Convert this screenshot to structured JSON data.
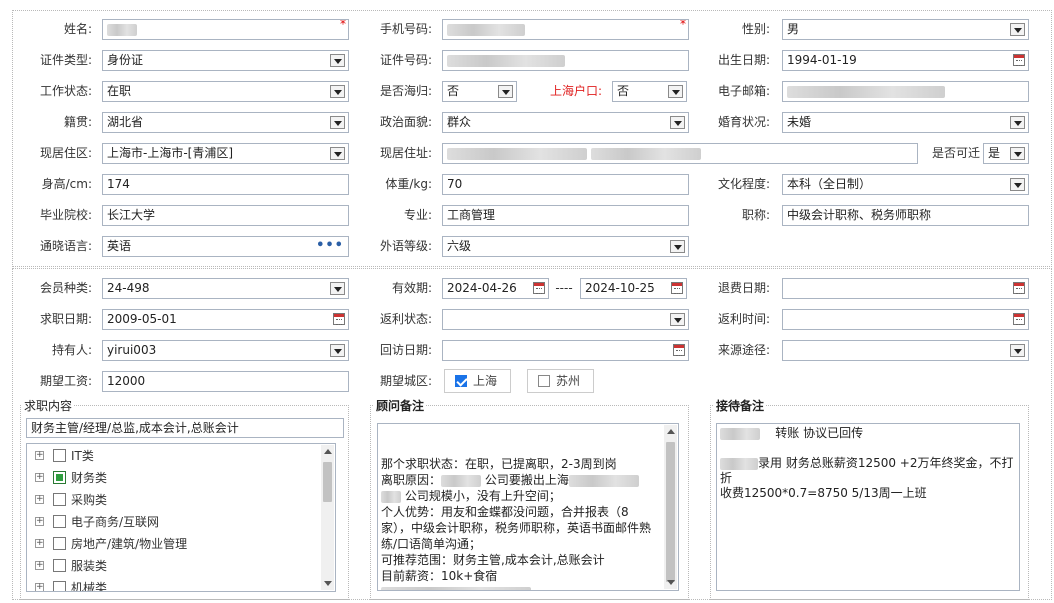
{
  "basic": {
    "name": {
      "label": "姓名:",
      "value": ""
    },
    "phone": {
      "label": "手机号码:",
      "value": ""
    },
    "gender": {
      "label": "性别:",
      "value": "男"
    },
    "id_type": {
      "label": "证件类型:",
      "value": "身份证"
    },
    "id_number": {
      "label": "证件号码:",
      "value": ""
    },
    "birth_date": {
      "label": "出生日期:",
      "value": "1994-01-19"
    },
    "work_status": {
      "label": "工作状态:",
      "value": "在职"
    },
    "returnee": {
      "label": "是否海归:",
      "value": "否"
    },
    "shanghai_hukou": {
      "label": "上海户口:",
      "value": "否"
    },
    "email": {
      "label": "电子邮箱:",
      "value": ""
    },
    "native_place": {
      "label": "籍贯:",
      "value": "湖北省"
    },
    "political": {
      "label": "政治面貌:",
      "value": "群众"
    },
    "marital": {
      "label": "婚育状况:",
      "value": "未婚"
    },
    "residence_area": {
      "label": "现居住区:",
      "value": "上海市-上海市-[青浦区]"
    },
    "residence_address": {
      "label": "现居住址:",
      "value": ""
    },
    "reachable": {
      "label": "是否可迁",
      "value": "是"
    },
    "height": {
      "label": "身高/cm:",
      "value": "174"
    },
    "weight": {
      "label": "体重/kg:",
      "value": "70"
    },
    "education": {
      "label": "文化程度:",
      "value": "本科（全日制）"
    },
    "school": {
      "label": "毕业院校:",
      "value": "长江大学"
    },
    "major": {
      "label": "专业:",
      "value": "工商管理"
    },
    "title": {
      "label": "职称:",
      "value": "中级会计职称、税务师职称"
    },
    "language": {
      "label": "通晓语言:",
      "value": "英语"
    },
    "foreign_level": {
      "label": "外语等级:",
      "value": "六级"
    }
  },
  "membership": {
    "member_type": {
      "label": "会员种类:",
      "value": "24-498"
    },
    "valid_period": {
      "label": "有效期:",
      "start": "2024-04-26",
      "sep": "----",
      "end": "2024-10-25"
    },
    "refund_date": {
      "label": "退费日期:",
      "value": ""
    },
    "job_date": {
      "label": "求职日期:",
      "value": "2009-05-01"
    },
    "rebate_status": {
      "label": "返利状态:",
      "value": ""
    },
    "rebate_time": {
      "label": "返利时间:",
      "value": ""
    },
    "holder": {
      "label": "持有人:",
      "value": "yirui003"
    },
    "visit_date": {
      "label": "回访日期:",
      "value": ""
    },
    "source": {
      "label": "来源途径:",
      "value": ""
    },
    "expected_salary": {
      "label": "期望工资:",
      "value": "12000"
    },
    "expected_city": {
      "label": "期望城区:",
      "options": [
        {
          "label": "上海",
          "checked": true
        },
        {
          "label": "苏州",
          "checked": false
        }
      ]
    }
  },
  "job_content": {
    "title": "求职内容",
    "selected": "财务主管/经理/总监,成本会计,总账会计",
    "tree": [
      {
        "label": "IT类",
        "checked": false
      },
      {
        "label": "财务类",
        "checked": true
      },
      {
        "label": "采购类",
        "checked": false
      },
      {
        "label": "电子商务/互联网",
        "checked": false
      },
      {
        "label": "房地产/建筑/物业管理",
        "checked": false
      },
      {
        "label": "服装类",
        "checked": false
      },
      {
        "label": "机械类",
        "checked": false
      }
    ]
  },
  "consultant_notes": {
    "title": "顾问备注",
    "lines": [
      "那个求职状态：在职，已提离职，2-3周到岗",
      "离职原因：",
      "公司要搬出上海",
      "公司规模小，没有上升空间；",
      "个人优势：用友和金蝶都没问题，合并报表（8",
      "家），中级会计职称，税务师职称，英语书面邮件熟",
      "练/口语简单沟通；",
      "可推荐范围：财务主管,成本会计,总账会计",
      "目前薪资：10k+食宿"
    ]
  },
  "reception_notes": {
    "title": "接待备注",
    "line1": "转账   协议已回传",
    "line2": "录用  财务总账薪资12500 +2万年终奖金，不打折",
    "line3": "收费12500*0.7=8750 5/13周一上班"
  },
  "colors": {
    "required": "#e00000",
    "hukou_label": "#e02020",
    "checked_green": "#2e9e3e",
    "checked_blue": "#1a73e8"
  }
}
